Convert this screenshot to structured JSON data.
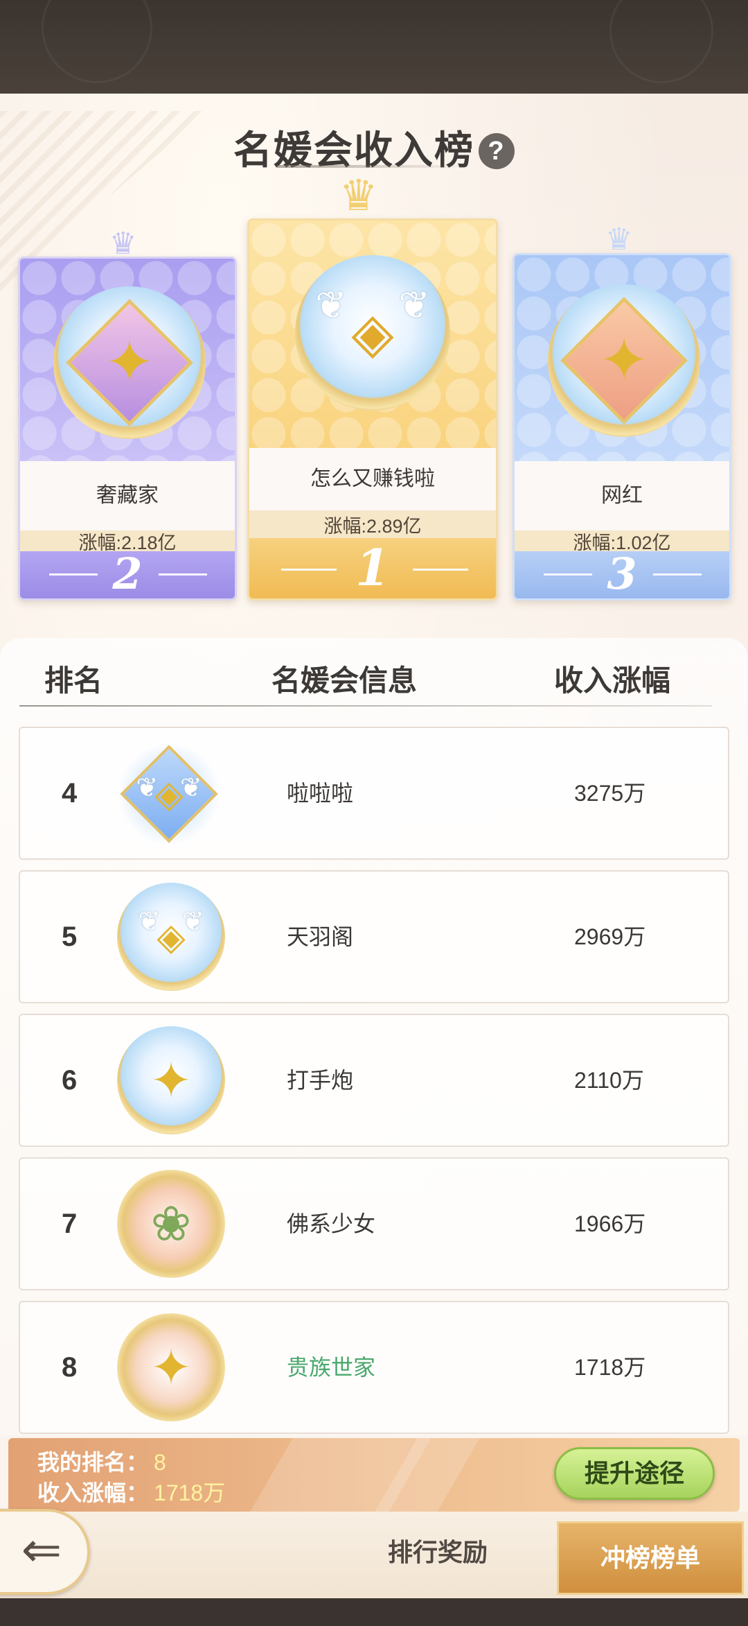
{
  "header": {
    "title": "名媛会收入榜",
    "help_icon": "question-mark-icon"
  },
  "podium": [
    {
      "rank": "2",
      "name": "奢藏家",
      "growth": "涨幅:2.18亿",
      "emblem": "star-hands-emblem",
      "theme": "#a99df0"
    },
    {
      "rank": "1",
      "name": "怎么又赚钱啦",
      "growth": "涨幅:2.89亿",
      "emblem": "winged-shield-emblem",
      "theme": "#f9d37e"
    },
    {
      "rank": "3",
      "name": "网红",
      "growth": "涨幅:1.02亿",
      "emblem": "star-hands-emblem",
      "theme": "#a9c6f6"
    }
  ],
  "list": {
    "headers": {
      "rank": "排名",
      "info": "名媛会信息",
      "income": "收入涨幅"
    },
    "rows": [
      {
        "rank": "4",
        "name": "啦啦啦",
        "income": "3275万",
        "emblem": "winged-diamond-emblem"
      },
      {
        "rank": "5",
        "name": "天羽阁",
        "income": "2969万",
        "emblem": "winged-shield-emblem"
      },
      {
        "rank": "6",
        "name": "打手炮",
        "income": "2110万",
        "emblem": "star-hands-emblem"
      },
      {
        "rank": "7",
        "name": "佛系少女",
        "income": "1966万",
        "emblem": "lily-emblem"
      },
      {
        "rank": "8",
        "name": "贵族世家",
        "income": "1718万",
        "emblem": "star-hands-emblem",
        "highlight": true
      }
    ]
  },
  "my_rank": {
    "rank_label": "我的排名：",
    "rank_value": "8",
    "income_label": "收入涨幅：",
    "income_value": "1718万",
    "upgrade_button": "提升途径"
  },
  "tabs": {
    "back_icon": "back-arrow-icon",
    "reward": "排行奖励",
    "climb": "冲榜榜单"
  },
  "colors": {
    "highlight_name": "#4aa86d",
    "upgrade_button": "#a6d35d",
    "active_tab": "#cf8e3c"
  }
}
